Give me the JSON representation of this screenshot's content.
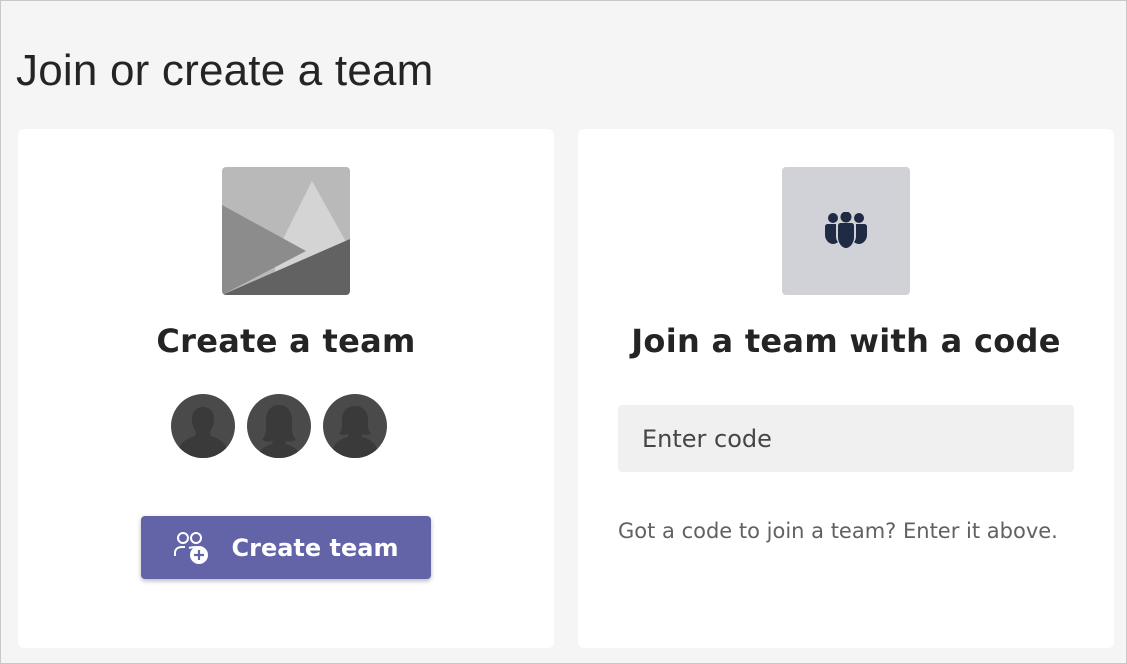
{
  "page": {
    "title": "Join or create a team"
  },
  "create_card": {
    "hero_icon": "team-picture-placeholder-icon",
    "title": "Create a team",
    "avatars": [
      "person-avatar-icon",
      "person-avatar-icon",
      "person-avatar-icon"
    ],
    "button": {
      "label": "Create team",
      "icon": "add-people-icon",
      "color": "#6264a7"
    }
  },
  "join_card": {
    "hero_icon": "people-team-icon",
    "title": "Join a team with a code",
    "input": {
      "value": "",
      "placeholder": "Enter code"
    },
    "hint": "Got a code to join a team? Enter it above."
  },
  "colors": {
    "background": "#f5f5f5",
    "card": "#ffffff",
    "accent": "#6264a7",
    "input_background": "#f0f0f0"
  }
}
